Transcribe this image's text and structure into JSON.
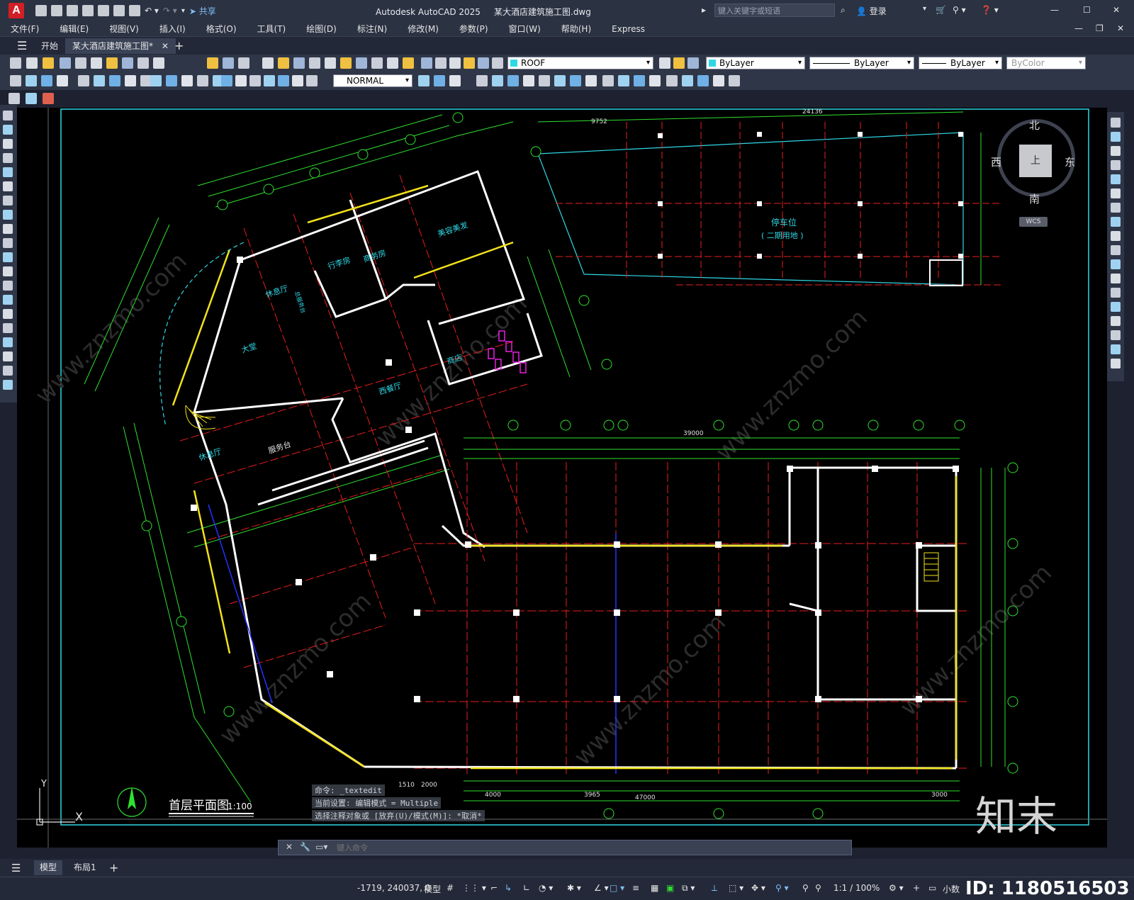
{
  "app": {
    "logo": "A",
    "title": "Autodesk AutoCAD 2025",
    "document": "某大酒店建筑施工图.dwg",
    "share_label": "共享",
    "search_placeholder": "键入关键字或短语",
    "login_label": "登录"
  },
  "menu": [
    "文件(F)",
    "编辑(E)",
    "视图(V)",
    "插入(I)",
    "格式(O)",
    "工具(T)",
    "绘图(D)",
    "标注(N)",
    "修改(M)",
    "参数(P)",
    "窗口(W)",
    "帮助(H)",
    "Express"
  ],
  "tabs": {
    "start": "开始",
    "drawing": "某大酒店建筑施工图*",
    "add": "+"
  },
  "toolbar": {
    "layer_value": "ROOF",
    "color_value": "ByLayer",
    "linetype_value": "ByLayer",
    "lineweight_value": "ByLayer",
    "plotstyle_value": "ByColor",
    "dimstyle_value": "NORMAL"
  },
  "viewcube": {
    "north": "北",
    "south": "南",
    "west": "西",
    "east": "东",
    "top": "上",
    "wcs": "WCS"
  },
  "drawing": {
    "plan_title": "首层平面图",
    "plan_scale": "1:100",
    "parking_label": "停车位",
    "parking_sub": "( 二期用地 )",
    "rooms": [
      "美容美发",
      "商务房",
      "行李房",
      "休息厅",
      "大堂",
      "西餐厅",
      "商店",
      "休息厅",
      "服务台",
      "总服务台"
    ],
    "dims_top": [
      "9752",
      "24136",
      "39000",
      "47000"
    ],
    "dims_bottom": [
      "1510",
      "2000",
      "4000",
      "3965",
      "3000"
    ],
    "ucs_x": "X",
    "ucs_y": "Y",
    "watermark": "www.znzmo.com",
    "brand": "知末",
    "id_label": "ID: 1180516503"
  },
  "command": {
    "history": [
      "命令:  _textedit",
      "当前设置: 编辑模式 = Multiple",
      "选择注释对象或 [放弃(U)/模式(M)]: *取消*"
    ],
    "placeholder": "键入命令"
  },
  "layouts": {
    "model": "模型",
    "layout1": "布局1",
    "add": "+"
  },
  "status": {
    "coords": "-1719, 240037, 0",
    "mode": "模型",
    "scale": "1:1 / 100%",
    "units": "小数"
  }
}
